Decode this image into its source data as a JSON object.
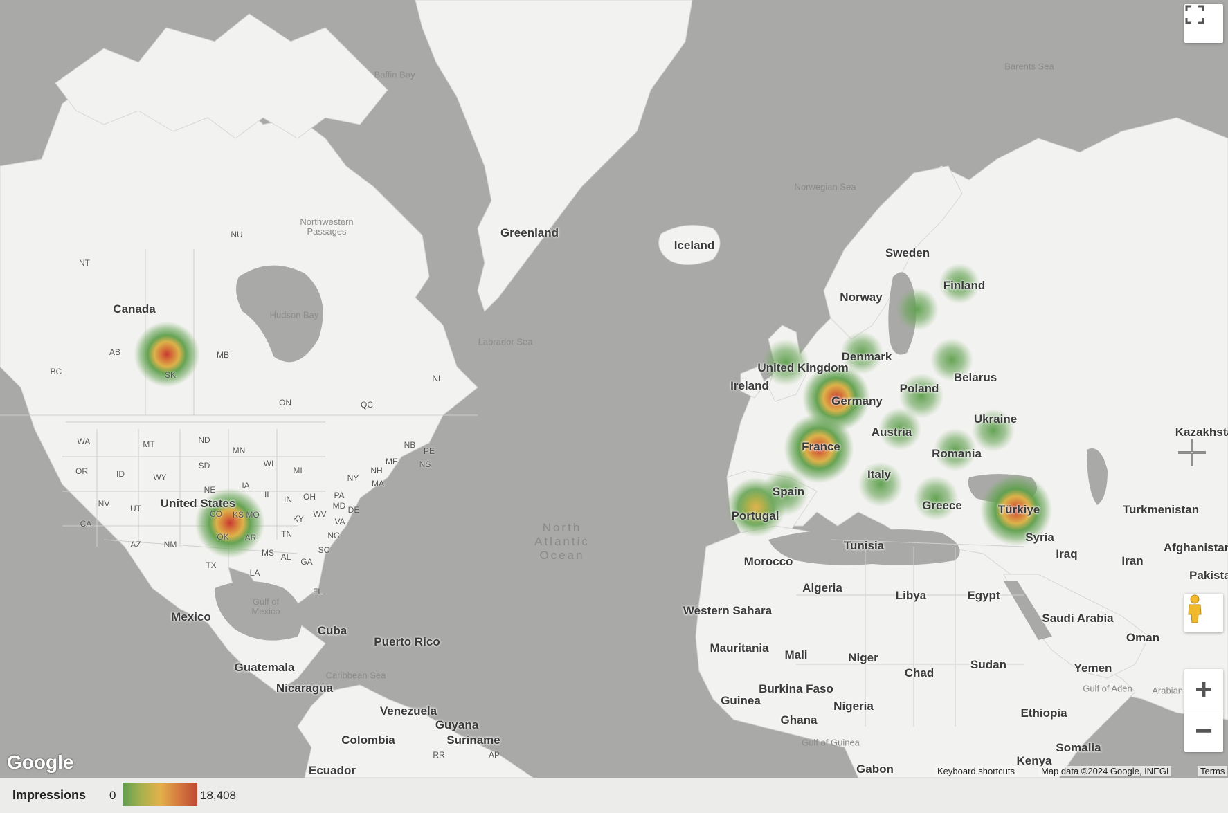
{
  "map": {
    "countries": [
      "Canada",
      "United States",
      "Mexico",
      "Cuba",
      "Puerto Rico",
      "Guatemala",
      "Nicaragua",
      "Venezuela",
      "Guyana",
      "Suriname",
      "Colombia",
      "Ecuador",
      "Greenland",
      "Iceland",
      "Sweden",
      "Finland",
      "Norway",
      "Denmark",
      "United Kingdom",
      "Ireland",
      "Belarus",
      "Poland",
      "Germany",
      "Ukraine",
      "Austria",
      "Kazakhstan",
      "France",
      "Romania",
      "Italy",
      "Spain",
      "Portugal",
      "Greece",
      "Türkiye",
      "Turkmenistan",
      "Syria",
      "Iraq",
      "Iran",
      "Afghanistan",
      "Pakistan",
      "Tunisia",
      "Morocco",
      "Algeria",
      "Libya",
      "Egypt",
      "Western Sahara",
      "Saudi Arabia",
      "Oman",
      "Mauritania",
      "Mali",
      "Niger",
      "Chad",
      "Sudan",
      "Yemen",
      "Burkina Faso",
      "Guinea",
      "Nigeria",
      "Ghana",
      "Ethiopia",
      "Somalia",
      "Kenya",
      "Gabon"
    ],
    "states": [
      "NU",
      "NT",
      "AB",
      "MB",
      "BC",
      "SK",
      "ON",
      "QC",
      "NL",
      "NB",
      "PE",
      "NS",
      "WA",
      "MT",
      "ND",
      "MN",
      "OR",
      "ID",
      "WY",
      "SD",
      "WI",
      "MI",
      "NY",
      "NH",
      "ME",
      "MA",
      "NV",
      "UT",
      "NE",
      "IA",
      "IL",
      "IN",
      "OH",
      "PA",
      "MD",
      "DE",
      "CA",
      "CO",
      "MO",
      "KY",
      "WV",
      "VA",
      "AZ",
      "NM",
      "KS",
      "OK",
      "AR",
      "TN",
      "NC",
      "SC",
      "MS",
      "AL",
      "GA",
      "TX",
      "LA",
      "FL",
      "RR",
      "AP"
    ],
    "water": [
      "Baffin Bay",
      "Barents Sea",
      "Northwestern Passages",
      "Hudson Bay",
      "Labrador Sea",
      "Norwegian Sea",
      "Gulf of Mexico",
      "Caribbean Sea",
      "Gulf of Guinea",
      "Gulf of Aden",
      "Arabian Sea"
    ],
    "ocean": "North Atlantic Ocean"
  },
  "controls": {
    "fullscreen_icon": "fullscreen-icon",
    "pegman_icon": "pegman-icon",
    "zoom_in": "+",
    "zoom_out": "−"
  },
  "attribution": {
    "logo": "Google",
    "keyboard_shortcuts": "Keyboard shortcuts",
    "map_data": "Map data ©2024 Google, INEGI",
    "terms": "Terms"
  },
  "legend": {
    "title": "Impressions",
    "min": "0",
    "max": "18,408",
    "colors": [
      "#5f9e4f",
      "#a7b14d",
      "#e2b14b",
      "#d67a3f",
      "#bd4a33"
    ]
  },
  "heatmap": {
    "max_value": 18408,
    "points": [
      {
        "place": "Saskatchewan",
        "weight": 0.85
      },
      {
        "place": "Oklahoma",
        "weight": 0.95
      },
      {
        "place": "Germany",
        "weight": 0.9
      },
      {
        "place": "France",
        "weight": 0.95
      },
      {
        "place": "Türkiye",
        "weight": 1.0
      },
      {
        "place": "Portugal",
        "weight": 0.7
      },
      {
        "place": "Spain",
        "weight": 0.4
      },
      {
        "place": "United Kingdom",
        "weight": 0.4
      },
      {
        "place": "Sweden",
        "weight": 0.3
      },
      {
        "place": "Finland",
        "weight": 0.25
      },
      {
        "place": "Denmark",
        "weight": 0.3
      },
      {
        "place": "Poland",
        "weight": 0.35
      },
      {
        "place": "Austria",
        "weight": 0.3
      },
      {
        "place": "Ukraine",
        "weight": 0.3
      },
      {
        "place": "Romania",
        "weight": 0.3
      },
      {
        "place": "Italy",
        "weight": 0.35
      },
      {
        "place": "Greece",
        "weight": 0.35
      },
      {
        "place": "Baltics",
        "weight": 0.3
      }
    ]
  }
}
